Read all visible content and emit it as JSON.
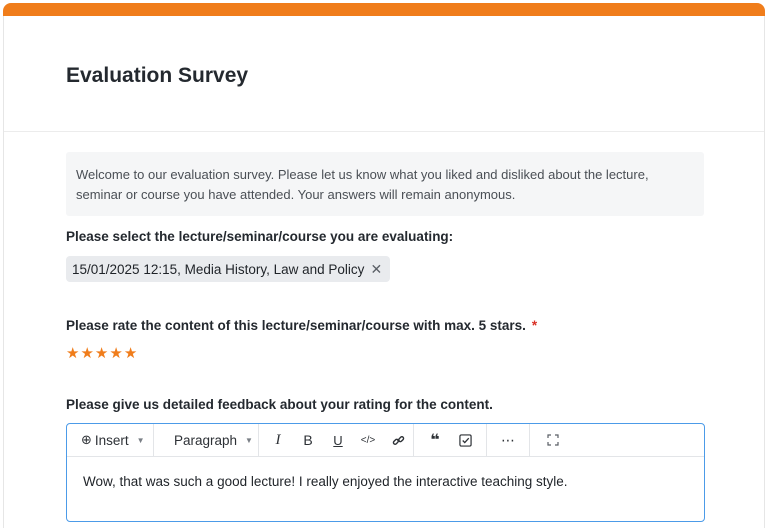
{
  "header": {
    "title": "Evaluation Survey"
  },
  "intro": {
    "line1": "Welcome to our evaluation survey. Please let us know what you liked and disliked about the lecture,",
    "line2": "seminar or course you have attended. Your answers will remain anonymous."
  },
  "question1": {
    "label": "Please select the lecture/seminar/course you are evaluating:",
    "selected_value": "15/01/2025 12:15, Media History, Law and Policy"
  },
  "question2": {
    "label": "Please rate the content of this lecture/seminar/course with max. 5 stars.",
    "required_marker": "*",
    "rating": 5,
    "max_rating": 5
  },
  "question3": {
    "label": "Please give us detailed feedback about your rating for the content."
  },
  "editor": {
    "toolbar": {
      "insert_label": "Insert",
      "block_format": "Paragraph"
    },
    "content": "Wow, that was such a good lecture! I really enjoyed the interactive teaching style."
  },
  "colors": {
    "accent": "#f07d1b",
    "focus_border": "#4c9be8",
    "required": "#d93025"
  }
}
